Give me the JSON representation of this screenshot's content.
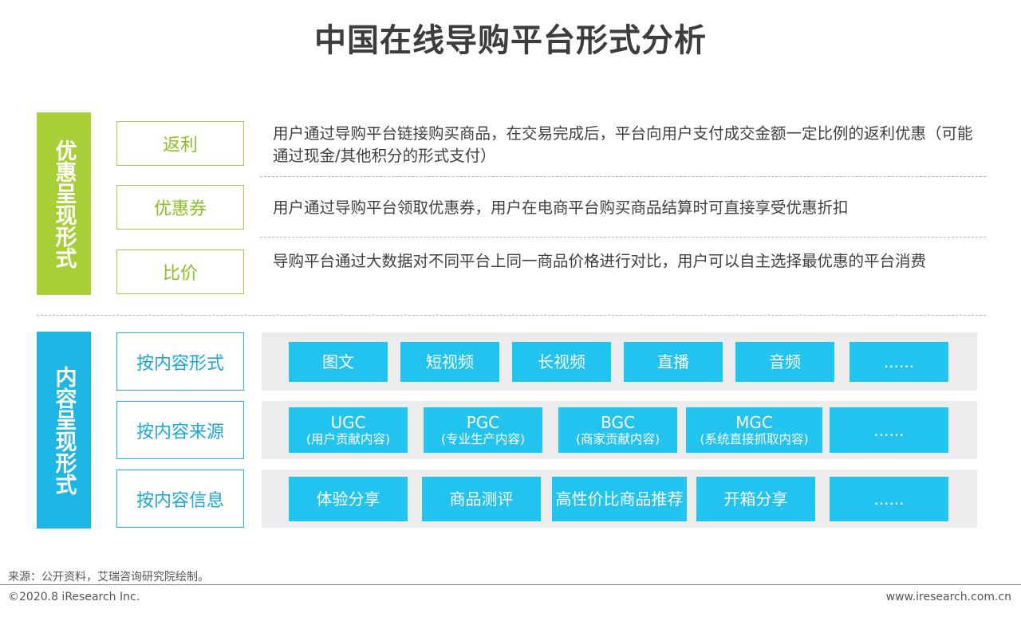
{
  "title": "中国在线导购平台形式分析",
  "discount": {
    "category": "优惠呈现形式",
    "items": [
      {
        "label": "返利",
        "desc": "用户通过导购平台链接购买商品，在交易完成后，平台向用户支付成交金额一定比例的返利优惠（可能通过现金/其他积分的形式支付）"
      },
      {
        "label": "优惠券",
        "desc": "用户通过导购平台领取优惠券，用户在电商平台购买商品结算时可直接享受优惠折扣"
      },
      {
        "label": "比价",
        "desc": "导购平台通过大数据对不同平台上同一商品价格进行对比，用户可以自主选择最优惠的平台消费"
      }
    ]
  },
  "content": {
    "category": "内容呈现形式",
    "rows": [
      {
        "label": "按内容形式",
        "chips": [
          {
            "main": "图文"
          },
          {
            "main": "短视频"
          },
          {
            "main": "长视频"
          },
          {
            "main": "直播"
          },
          {
            "main": "音频"
          },
          {
            "main": "......"
          }
        ]
      },
      {
        "label": "按内容来源",
        "chips": [
          {
            "main": "UGC",
            "sub": "(用户贡献内容)"
          },
          {
            "main": "PGC",
            "sub": "(专业生产内容)"
          },
          {
            "main": "BGC",
            "sub": "(商家贡献内容)"
          },
          {
            "main": "MGC",
            "sub": "(系统直接抓取内容)"
          },
          {
            "main": "......"
          }
        ]
      },
      {
        "label": "按内容信息",
        "chips": [
          {
            "main": "体验分享"
          },
          {
            "main": "商品测评"
          },
          {
            "main": "高性价比商品推荐"
          },
          {
            "main": "开箱分享"
          },
          {
            "main": "......"
          }
        ]
      }
    ]
  },
  "footer": {
    "source": "来源：公开资料，艾瑞咨询研究院绘制。",
    "copyright": "©2020.8 iResearch Inc.",
    "website": "www.iresearch.com.cn"
  }
}
